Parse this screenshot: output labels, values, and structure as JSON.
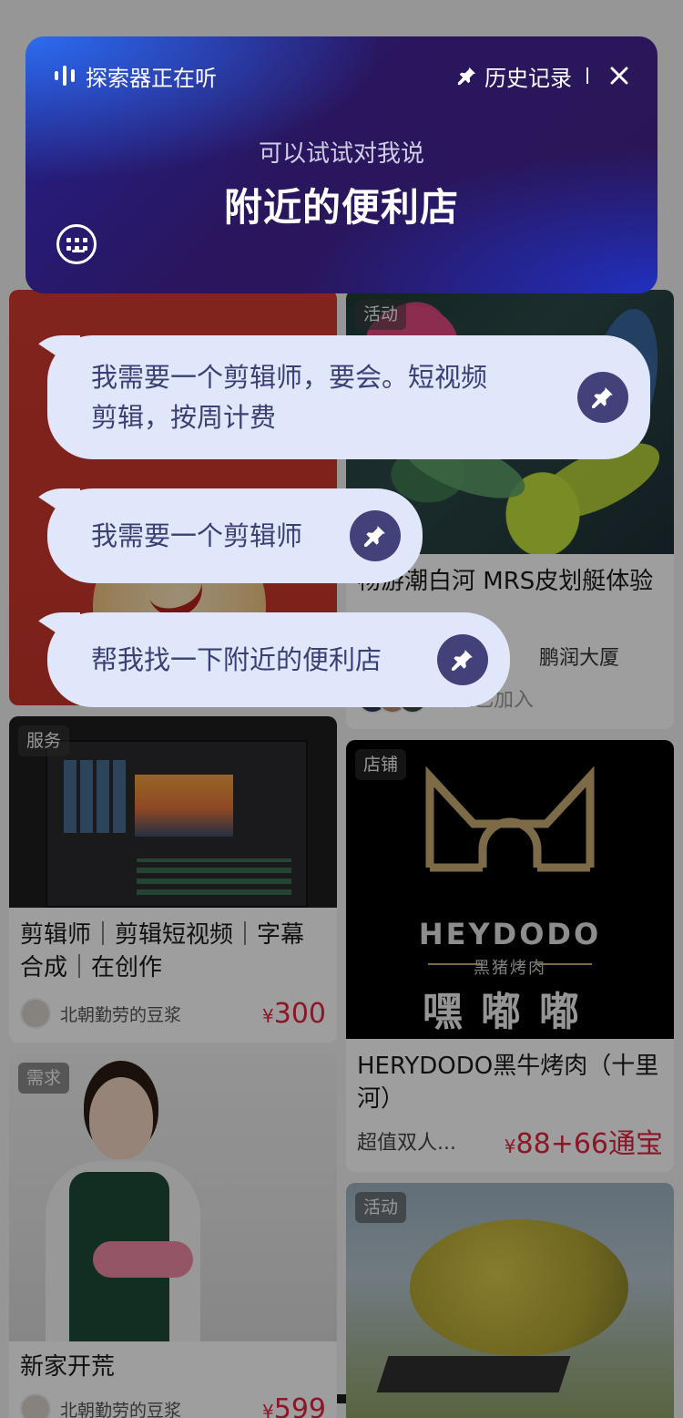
{
  "voice_panel": {
    "status": "探索器正在听",
    "history_label": "历史记录",
    "hint": "可以试试对我说",
    "query": "附近的便利店"
  },
  "history": [
    {
      "line1": "我需要一个剪辑师，要会。短视频",
      "line2": "剪辑，按周计费"
    },
    {
      "text": "我需要一个剪辑师"
    },
    {
      "text": "帮我找一下附近的便利店"
    }
  ],
  "feed": {
    "kayak": {
      "tag": "活动",
      "title": "畅游潮白河 MRS皮划艇体验",
      "location": "鹏润大厦",
      "joined": "3人已加入"
    },
    "editor": {
      "tag": "服务",
      "title": "剪辑师｜剪辑短视频｜字幕合成｜在创作",
      "author": "北朝勤劳的豆浆",
      "price_symbol": "¥",
      "price": "300"
    },
    "shop": {
      "tag": "店铺",
      "brand_en": "HEYDODO",
      "brand_sub": "黑猪烤肉",
      "brand_cn": "嘿嘟嘟",
      "title": "HERYDODO黑牛烤肉（十里河）",
      "deal": "超值双人...",
      "price_symbol": "¥",
      "price": "88+66通宝"
    },
    "worker": {
      "tag": "需求",
      "title": "新家开荒",
      "author": "北朝勤劳的豆浆",
      "price_symbol": "¥",
      "price": "599"
    },
    "tree": {
      "tag": "活动"
    }
  },
  "colors": {
    "panel_start": "#241f8a",
    "panel_end": "#2a1554",
    "bubble_bg": "#e1e7fb",
    "bubble_text": "#3b3f73",
    "pin_bg": "#43417a",
    "price": "#e3233f"
  },
  "icons": [
    "voice-wave-icon",
    "pin-icon",
    "close-icon",
    "keyboard-icon"
  ]
}
